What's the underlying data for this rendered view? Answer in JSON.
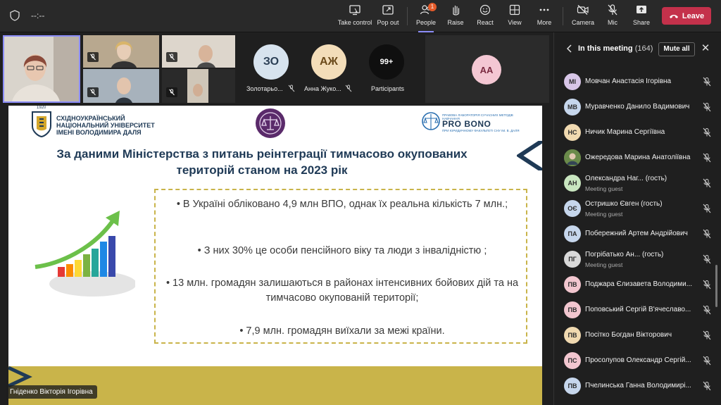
{
  "meeting": {
    "timer": "--:--"
  },
  "toolbar": {
    "take_control": "Take control",
    "pop_out": "Pop out",
    "people": "People",
    "people_badge": "1",
    "raise": "Raise",
    "react": "React",
    "view": "View",
    "more": "More",
    "camera": "Camera",
    "mic": "Mic",
    "share": "Share",
    "leave": "Leave"
  },
  "stage": {
    "participants": [
      {
        "initials": "ЗО",
        "name": "Золотарьо..."
      },
      {
        "initials": "АЖ",
        "name": "Анна Жуко..."
      },
      {
        "initials": "99+",
        "name": "Participants"
      }
    ],
    "extra_avatar": "АА"
  },
  "slide": {
    "university": [
      "СХІДНОУКРАЇНСЬКИЙ",
      "НАЦІОНАЛЬНИЙ УНІВЕРСИТЕТ",
      "ІМЕНІ ВОЛОДИМИРА ДАЛЯ"
    ],
    "year_badge": "1920",
    "pro_bono": "PRO BONO",
    "pro_bono_sub": "ПРАВОВА ЛАБОРАТОРІЯ СУЧАСНИХ МЕТОДІВ НАВЧАННЯ",
    "pro_bono_sub2": "ПРИ ЮРИДИЧНОМУ ФАКУЛЬТЕТІ СНУ ІМ. В. ДАЛЯ",
    "title": "За даними Міністерства з питань реінтеграції тимчасово окупованих територій станом на 2023 рік",
    "bullets": [
      "• В Україні обліковано 4,9 млн ВПО, однак їх реальна кількість 7 млн.;",
      "• З них 30% це особи пенсійного віку та люди з інвалідністю ;",
      "• 13 млн. громадян залишаються в районах інтенсивних бойових дій та на тимчасово окупованій території;",
      "• 7,9 млн. громадян виїхали за межі країни."
    ]
  },
  "presenter_name": "Гніденко Вікторія Ігорівна",
  "panel": {
    "title": "In this meeting",
    "count": "(164)",
    "mute_all": "Mute all",
    "people": [
      {
        "initials": "МІ",
        "name": "Мовчан Анастасія Ігорівна",
        "sub": "",
        "color": "#d8c6e8"
      },
      {
        "initials": "МВ",
        "name": "Муравченко Данило Вадимович",
        "sub": "",
        "color": "#c6d6ec"
      },
      {
        "initials": "НС",
        "name": "Ничик Марина Сергіївна",
        "sub": "",
        "color": "#f0d9b0"
      },
      {
        "initials": "",
        "name": "Ожередова Марина Анатоліївна",
        "sub": "",
        "color": "#6a8a4a"
      },
      {
        "initials": "АН",
        "name": "Олександра Наг... (гость)",
        "sub": "Meeting guest",
        "color": "#c9e6c0"
      },
      {
        "initials": "ОЄ",
        "name": "Остришко Євген (гость)",
        "sub": "Meeting guest",
        "color": "#c6d6ec"
      },
      {
        "initials": "ПА",
        "name": "Побережний Артем Андрійович",
        "sub": "",
        "color": "#c6d6ec"
      },
      {
        "initials": "ПГ",
        "name": "Погрібатько Ан... (гость)",
        "sub": "Meeting guest",
        "color": "#d9d9d9"
      },
      {
        "initials": "ПВ",
        "name": "Поджара Єлизавета Володими...",
        "sub": "",
        "color": "#f2c6cf"
      },
      {
        "initials": "ПВ",
        "name": "Поповський Сергій В'ячеславо...",
        "sub": "",
        "color": "#f2c6cf"
      },
      {
        "initials": "ПВ",
        "name": "Посітко Богдан Вікторович",
        "sub": "",
        "color": "#f0d9b0"
      },
      {
        "initials": "ПС",
        "name": "Просолупов Олександр Сергій...",
        "sub": "",
        "color": "#f2c6cf"
      },
      {
        "initials": "ПВ",
        "name": "Пчелинська Ганна Володимирі...",
        "sub": "",
        "color": "#c6d6ec"
      }
    ]
  }
}
